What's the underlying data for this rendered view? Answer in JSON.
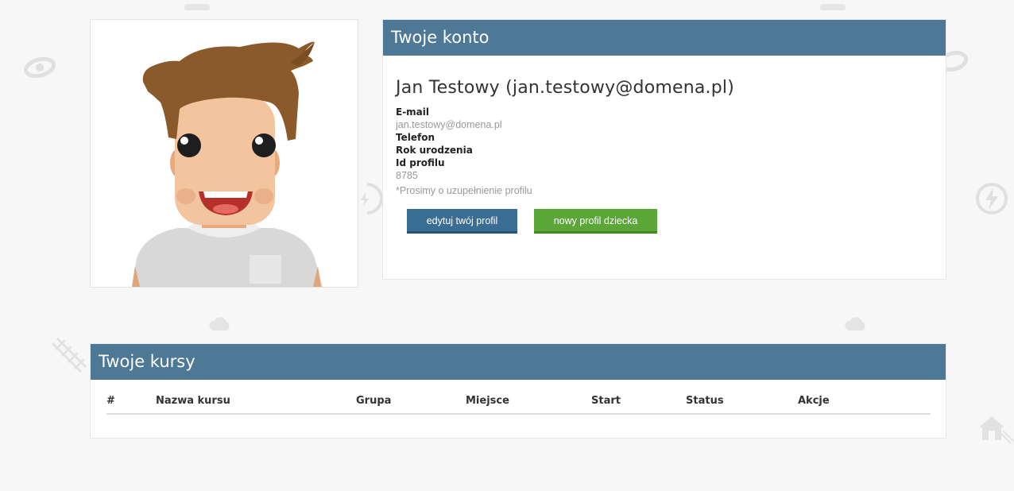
{
  "account": {
    "title": "Twoje konto",
    "user_name": "Jan Testowy (jan.testowy@domena.pl)",
    "email_label": "E-mail",
    "email_value": "jan.testowy@domena.pl",
    "phone_label": "Telefon",
    "birth_year_label": "Rok urodzenia",
    "profile_id_label": "Id profilu",
    "profile_id_value": "8785",
    "note": "*Prosimy o uzupełnienie profilu",
    "edit_button": "edytuj twój profil",
    "new_child_button": "nowy profil dziecka"
  },
  "courses": {
    "title": "Twoje kursy",
    "columns": [
      "#",
      "Nazwa kursu",
      "Grupa",
      "Miejsce",
      "Start",
      "Status",
      "Akcje"
    ],
    "rows": []
  },
  "colors": {
    "header": "#4d7896",
    "edit_button": "#3a6d94",
    "new_child_button": "#5aa738",
    "background": "#f7f7f7"
  },
  "icons": {
    "avatar": "cartoon-boy-avatar",
    "background_pattern": [
      "eye-icon",
      "cloud-icon",
      "lightning-icon",
      "house-icon"
    ]
  }
}
